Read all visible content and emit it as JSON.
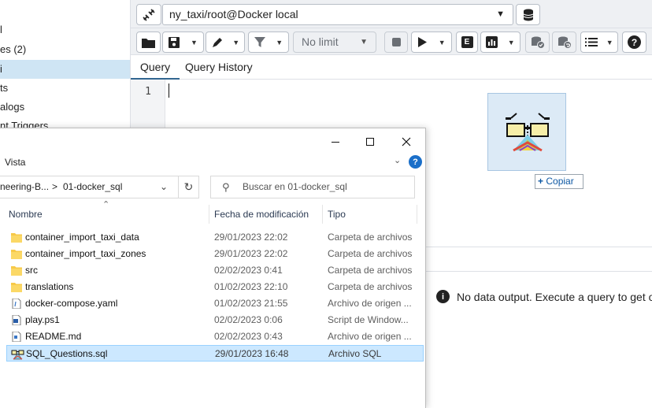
{
  "tree": {
    "items": [
      {
        "label": "l"
      },
      {
        "label": "es (2)"
      },
      {
        "label": "i",
        "selected": true
      },
      {
        "label": "ts"
      },
      {
        "label": "alogs"
      },
      {
        "label": "nt Triggers"
      }
    ]
  },
  "query_tool": {
    "connection": "ny_taxi/root@Docker local",
    "limit_label": "No limit",
    "tabs": [
      {
        "label": "Query",
        "active": true
      },
      {
        "label": "Query History"
      }
    ],
    "line_number": "1",
    "no_data_message": "No data output. Execute a query to get outp",
    "copy_tooltip": "Copiar",
    "copy_plus": "+"
  },
  "explorer": {
    "ribbon_label": "Vista",
    "help_label": "?",
    "address_prefix": "neering-B...",
    "address_sep": ">",
    "address_folder": "01-docker_sql",
    "search_placeholder": "Buscar en 01-docker_sql",
    "columns": {
      "name": "Nombre",
      "modified": "Fecha de modificación",
      "type": "Tipo"
    },
    "files": [
      {
        "name": "container_import_taxi_data",
        "modified": "29/01/2023 22:02",
        "type": "Carpeta de archivos",
        "icon": "folder-icon"
      },
      {
        "name": "container_import_taxi_zones",
        "modified": "29/01/2023 22:02",
        "type": "Carpeta de archivos",
        "icon": "folder-icon"
      },
      {
        "name": "src",
        "modified": "02/02/2023 0:41",
        "type": "Carpeta de archivos",
        "icon": "folder-icon"
      },
      {
        "name": "translations",
        "modified": "01/02/2023 22:10",
        "type": "Carpeta de archivos",
        "icon": "folder-icon"
      },
      {
        "name": "docker-compose.yaml",
        "modified": "01/02/2023 21:55",
        "type": "Archivo de origen ...",
        "icon": "yaml-file-icon"
      },
      {
        "name": "play.ps1",
        "modified": "02/02/2023 0:06",
        "type": "Script de Window...",
        "icon": "powershell-file-icon"
      },
      {
        "name": "README.md",
        "modified": "02/02/2023 0:43",
        "type": "Archivo de origen ...",
        "icon": "markdown-file-icon"
      },
      {
        "name": "SQL_Questions.sql",
        "modified": "29/01/2023 16:48",
        "type": "Archivo SQL",
        "icon": "sql-file-icon",
        "selected": true
      }
    ]
  },
  "colors": {
    "tree_selected": "#cfe5f4",
    "tab_active": "#326690",
    "row_selected": "#cce8ff",
    "folder": "#f7c948",
    "help": "#1a6fc9"
  }
}
